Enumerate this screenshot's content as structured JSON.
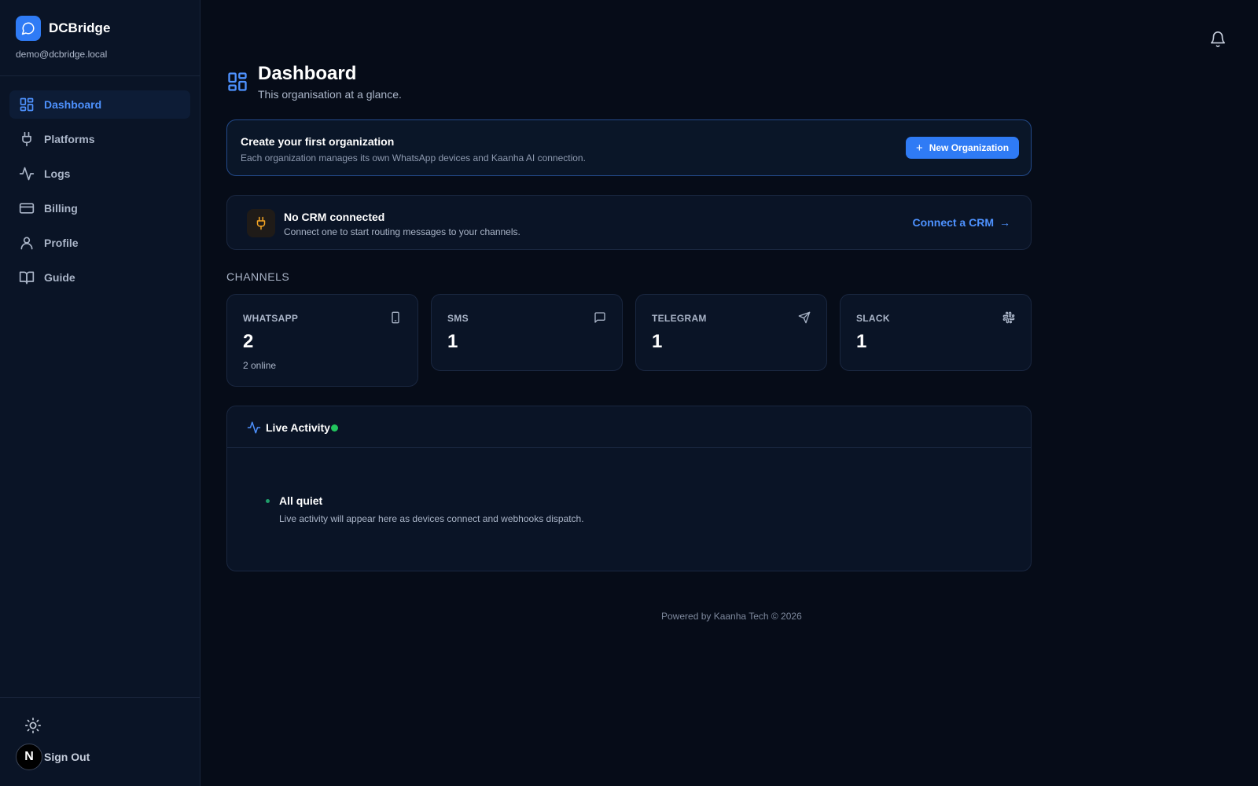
{
  "brand": {
    "name": "DCBridge",
    "email": "demo@dcbridge.local"
  },
  "sidebar": {
    "items": [
      {
        "label": "Dashboard",
        "icon": "dashboard-icon",
        "active": true
      },
      {
        "label": "Platforms",
        "icon": "plug-icon",
        "active": false
      },
      {
        "label": "Logs",
        "icon": "activity-icon",
        "active": false
      },
      {
        "label": "Billing",
        "icon": "credit-card-icon",
        "active": false
      },
      {
        "label": "Profile",
        "icon": "user-icon",
        "active": false
      },
      {
        "label": "Guide",
        "icon": "book-icon",
        "active": false
      }
    ],
    "avatar_letter": "N",
    "sign_out_label": "Sign Out"
  },
  "page": {
    "title": "Dashboard",
    "subtitle": "This organisation at a glance."
  },
  "org_banner": {
    "title": "Create your first organization",
    "description": "Each organization manages its own WhatsApp devices and Kaanha AI connection.",
    "button_label": "New Organization"
  },
  "crm": {
    "title": "No CRM connected",
    "description": "Connect one to start routing messages to your channels.",
    "link_label": "Connect a CRM"
  },
  "channels": {
    "label": "CHANNELS",
    "items": [
      {
        "name": "WHATSAPP",
        "count": "2",
        "status": "2 online",
        "icon": "phone-icon"
      },
      {
        "name": "SMS",
        "count": "1",
        "status": "",
        "icon": "message-square-icon"
      },
      {
        "name": "TELEGRAM",
        "count": "1",
        "status": "",
        "icon": "send-icon"
      },
      {
        "name": "SLACK",
        "count": "1",
        "status": "",
        "icon": "slack-icon"
      }
    ]
  },
  "activity": {
    "title": "Live Activity",
    "empty_title": "All quiet",
    "empty_description": "Live activity will appear here as devices connect and webhooks dispatch."
  },
  "footer": {
    "text": "Powered by Kaanha Tech © 2026"
  },
  "colors": {
    "accent": "#2f7bf5",
    "background": "#060c18",
    "sidebar": "#0a1426",
    "online": "#22c55e",
    "warning": "#f5a524"
  }
}
